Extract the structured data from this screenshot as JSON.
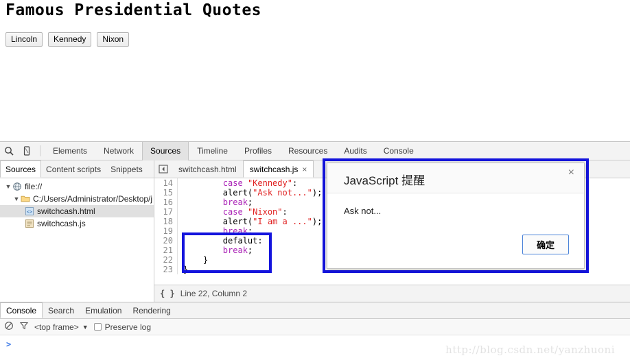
{
  "page": {
    "title": "Famous Presidential Quotes",
    "buttons": [
      {
        "label": "Lincoln"
      },
      {
        "label": "Kennedy"
      },
      {
        "label": "Nixon"
      }
    ]
  },
  "devtools": {
    "toolbar": {
      "search_icon": "search-icon",
      "device_icon": "device-toggle-icon",
      "tabs": [
        {
          "label": "Elements",
          "active": false
        },
        {
          "label": "Network",
          "active": false
        },
        {
          "label": "Sources",
          "active": true
        },
        {
          "label": "Timeline",
          "active": false
        },
        {
          "label": "Profiles",
          "active": false
        },
        {
          "label": "Resources",
          "active": false
        },
        {
          "label": "Audits",
          "active": false
        },
        {
          "label": "Console",
          "active": false
        }
      ]
    },
    "sources_panel": {
      "subtabs": [
        {
          "label": "Sources",
          "active": true
        },
        {
          "label": "Content scripts",
          "active": false
        },
        {
          "label": "Snippets",
          "active": false
        }
      ],
      "tree": [
        {
          "label": "file://",
          "depth": 0,
          "icon": "globe-icon",
          "expanded": true,
          "selected": false
        },
        {
          "label": "C:/Users/Administrator/Desktop/j",
          "depth": 1,
          "icon": "folder-icon",
          "expanded": true,
          "selected": false
        },
        {
          "label": "switchcash.html",
          "depth": 2,
          "icon": "html-file-icon",
          "expanded": null,
          "selected": true
        },
        {
          "label": "switchcash.js",
          "depth": 2,
          "icon": "js-file-icon",
          "expanded": null,
          "selected": false
        }
      ],
      "editor_tabs": [
        {
          "label": "switchcash.html",
          "active": false,
          "closable": false
        },
        {
          "label": "switchcash.js",
          "active": true,
          "closable": true
        }
      ],
      "close_glyph": "×",
      "code": [
        {
          "num": "14",
          "tokens": [
            {
              "t": "        ",
              "c": "pun"
            },
            {
              "t": "case",
              "c": "k"
            },
            {
              "t": " ",
              "c": "pun"
            },
            {
              "t": "\"Kennedy\"",
              "c": "str"
            },
            {
              "t": ":",
              "c": "pun"
            }
          ]
        },
        {
          "num": "15",
          "tokens": [
            {
              "t": "        alert(",
              "c": "pun"
            },
            {
              "t": "\"Ask not...\"",
              "c": "str"
            },
            {
              "t": ");",
              "c": "pun"
            }
          ]
        },
        {
          "num": "16",
          "tokens": [
            {
              "t": "        ",
              "c": "pun"
            },
            {
              "t": "break",
              "c": "k"
            },
            {
              "t": ";",
              "c": "pun"
            }
          ]
        },
        {
          "num": "17",
          "tokens": [
            {
              "t": "        ",
              "c": "pun"
            },
            {
              "t": "case",
              "c": "k"
            },
            {
              "t": " ",
              "c": "pun"
            },
            {
              "t": "\"Nixon\"",
              "c": "str"
            },
            {
              "t": ":",
              "c": "pun"
            }
          ]
        },
        {
          "num": "18",
          "tokens": [
            {
              "t": "        alert(",
              "c": "pun"
            },
            {
              "t": "\"I am a ...\"",
              "c": "str"
            },
            {
              "t": ");",
              "c": "pun"
            }
          ]
        },
        {
          "num": "19",
          "tokens": [
            {
              "t": "        ",
              "c": "pun"
            },
            {
              "t": "break",
              "c": "k"
            },
            {
              "t": ";",
              "c": "pun"
            }
          ]
        },
        {
          "num": "20",
          "tokens": [
            {
              "t": "        defalut:",
              "c": "pun"
            }
          ]
        },
        {
          "num": "21",
          "tokens": [
            {
              "t": "        ",
              "c": "pun"
            },
            {
              "t": "break",
              "c": "k"
            },
            {
              "t": ";",
              "c": "pun"
            }
          ]
        },
        {
          "num": "22",
          "tokens": [
            {
              "t": "    }",
              "c": "pun"
            }
          ]
        },
        {
          "num": "23",
          "tokens": [
            {
              "t": "}",
              "c": "pun"
            }
          ]
        }
      ],
      "status": {
        "format_icon": "{ }",
        "position": "Line 22, Column 2"
      }
    },
    "drawer": {
      "tabs": [
        {
          "label": "Console",
          "active": true
        },
        {
          "label": "Search",
          "active": false
        },
        {
          "label": "Emulation",
          "active": false
        },
        {
          "label": "Rendering",
          "active": false
        }
      ],
      "clear_icon": "clear-console-icon",
      "filter_icon": "filter-icon",
      "frame": "<top frame>",
      "frame_caret": "▼",
      "preserve_log": "Preserve log",
      "preserve_log_checked": false,
      "prompt": ">"
    }
  },
  "dialog": {
    "title": "JavaScript 提醒",
    "message": "Ask not...",
    "ok_label": "确定",
    "close_glyph": "×",
    "border_color": "#1414dd"
  },
  "watermark": "http://blog.csdn.net/yanzhuoni",
  "highlight": {
    "color": "#1414dd"
  }
}
